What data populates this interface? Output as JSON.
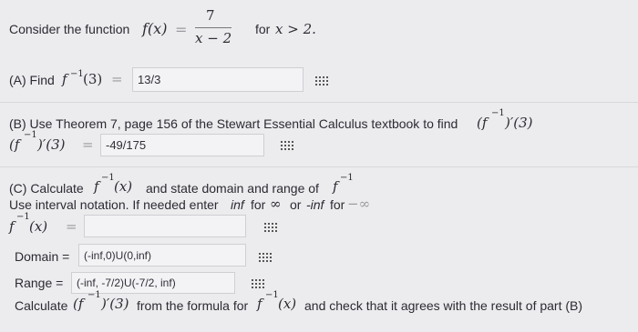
{
  "intro": {
    "text": "Consider the function",
    "fx": "f(x)",
    "eq": "=",
    "numerator": "7",
    "denominator": "x − 2",
    "condition_text": "for",
    "condition_math": "x > 2."
  },
  "partA": {
    "label": "(A) Find",
    "func": "f",
    "sup": "−1",
    "arg": "(3)",
    "eq": "=",
    "answer": "13/3"
  },
  "partB": {
    "label": "(B) Use Theorem 7, page 156 of the Stewart Essential Calculus textbook to find",
    "expr": "(f",
    "sup": "−1",
    "expr_rest": ")′(3)",
    "lhs": "(f",
    "lhs_sup": "−1",
    "lhs_rest": ")′(3)",
    "eq": "=",
    "answer": "-49/175"
  },
  "partC": {
    "label_start": "(C) Calculate",
    "func": "f",
    "sup": "−1",
    "arg": "(x)",
    "label_mid": "and state domain and range of",
    "func2": "f",
    "sup2": "−1",
    "note_start": "Use interval notation. If needed enter",
    "note_inf": "inf",
    "note_for1": "for",
    "note_sym1": "∞",
    "note_or": "or",
    "note_neginf": "-inf",
    "note_for2": "for",
    "note_sym2": "−∞",
    "inverse_lhs": "f",
    "inverse_sup": "−1",
    "inverse_arg": "(x)",
    "inverse_eq": "=",
    "inverse_value": "",
    "domain_label": "Domain =",
    "domain_value": "(-inf,0)U(0,inf)",
    "range_label": "Range =",
    "range_value": "(-inf, -7/2)U(-7/2, inf)",
    "calc_start": "Calculate",
    "calc_expr": "(f",
    "calc_sup": "−1",
    "calc_rest": ")′(3)",
    "calc_mid": "from the formula for",
    "calc_func": "f",
    "calc_sup2": "−1",
    "calc_arg": "(x)",
    "calc_end": "and check that it agrees with the result of part (B)"
  }
}
